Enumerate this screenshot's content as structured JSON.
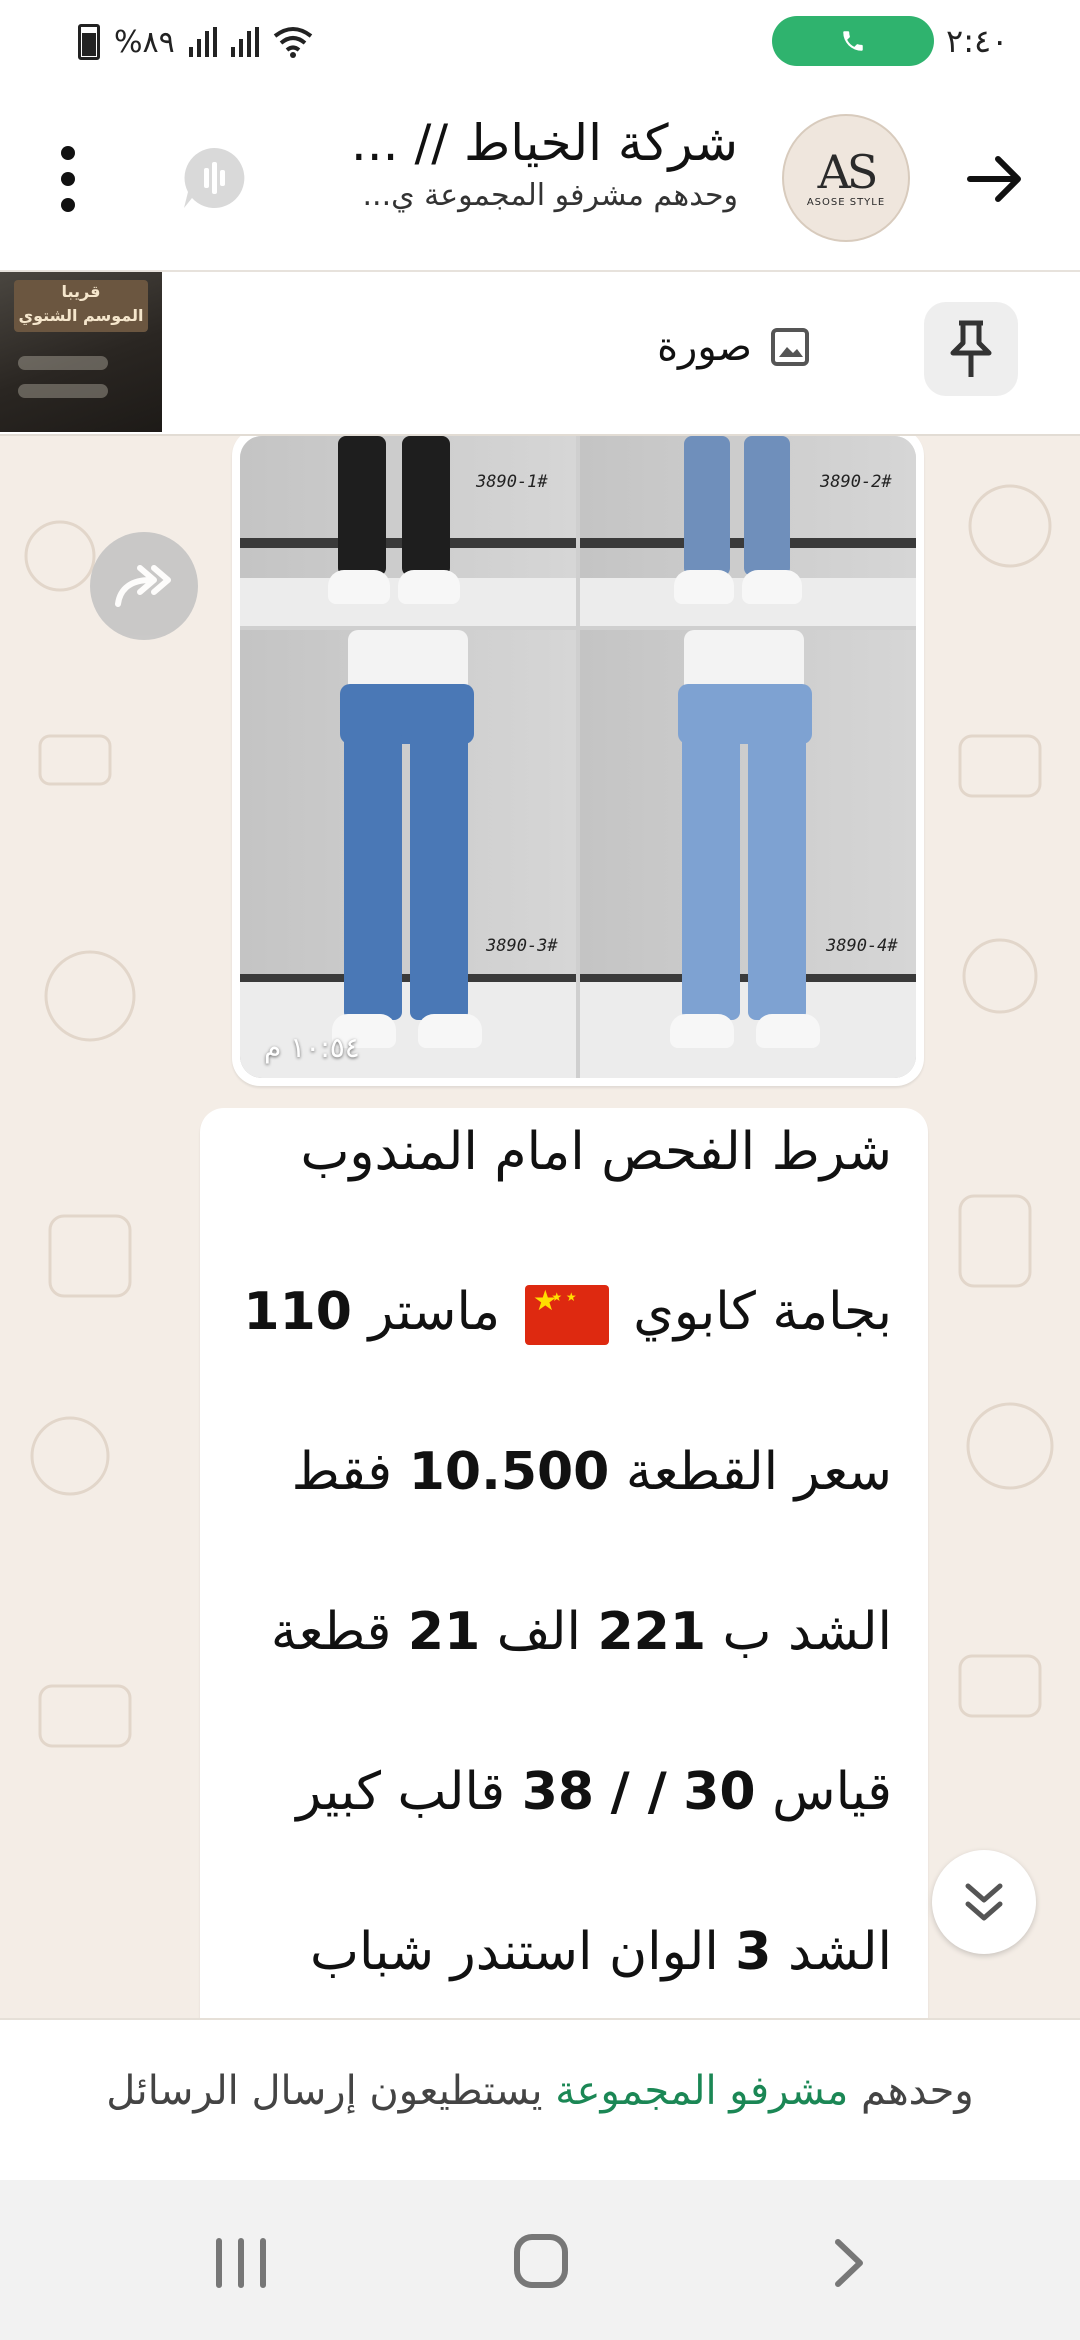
{
  "status_bar": {
    "time": "٢:٤٠",
    "battery": "%٨٩",
    "call_pill_color": "#2fb36e"
  },
  "header": {
    "title": "شركة الخياط // ...",
    "subtitle": "وحدهم مشرفو المجموعة ي...",
    "avatar_monogram": "AS",
    "avatar_brand": "ASOSE STYLE",
    "icons": [
      "arrow-right-icon",
      "voice-chat-icon",
      "more-vert-icon"
    ]
  },
  "pinned": {
    "label": "صورة",
    "thumb_banner_line1": "قريبا",
    "thumb_banner_line2": "الموسم الشتوي",
    "icons": [
      "pin-icon",
      "image-icon"
    ]
  },
  "image_message": {
    "time": "١٠:٥٤ م",
    "codes": [
      "3890-1#",
      "3890-2#",
      "3890-3#",
      "3890-4#"
    ]
  },
  "text_message": {
    "line1": "شرط الفحص امام المندوب",
    "line2_a": "بجامة كابوي",
    "line2_b": "ماستر",
    "line2_num": "110",
    "line3_a": "سعر القطعة",
    "line3_num": "10.500",
    "line3_b": "فقط",
    "line4_a": "الشد ب",
    "line4_num1": "221",
    "line4_b": "الف",
    "line4_num2": "21",
    "line4_c": "قطعة",
    "line5_a": "قياس",
    "line5_num1": "30",
    "line5_sep": "/ /",
    "line5_num2": "38",
    "line5_b": "قالب كبير",
    "line6_a": "الشد",
    "line6_num": "3",
    "line6_b": "الوان استندر شباب"
  },
  "notice": {
    "prefix": "وحدهم",
    "link": "مشرفو المجموعة",
    "suffix": "يستطيعون إرسال الرسائل",
    "link_color": "#1b8755"
  },
  "nav": {
    "icons": [
      "recents-icon",
      "home-icon",
      "back-icon"
    ]
  }
}
